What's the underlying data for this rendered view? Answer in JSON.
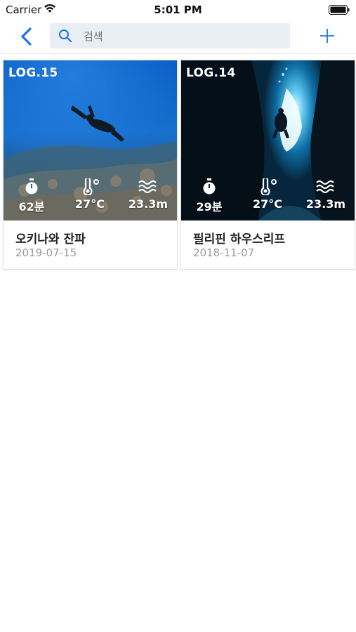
{
  "status_bar": {
    "carrier": "Carrier",
    "time": "5:01 PM"
  },
  "nav": {
    "search_placeholder": "검색",
    "search_value": ""
  },
  "logs": [
    {
      "log": "LOG.15",
      "duration": "62분",
      "temperature": "27°C",
      "depth": "23.3m",
      "title": "오키나와 잔파",
      "date": "2019-07-15"
    },
    {
      "log": "LOG.14",
      "duration": "29분",
      "temperature": "27°C",
      "depth": "23.3m",
      "title": "필리핀 하우스리프",
      "date": "2018-11-07"
    }
  ],
  "colors": {
    "accent": "#1a73e8",
    "search_bg": "#e9eef5",
    "date_gray": "#9a9a9a"
  }
}
